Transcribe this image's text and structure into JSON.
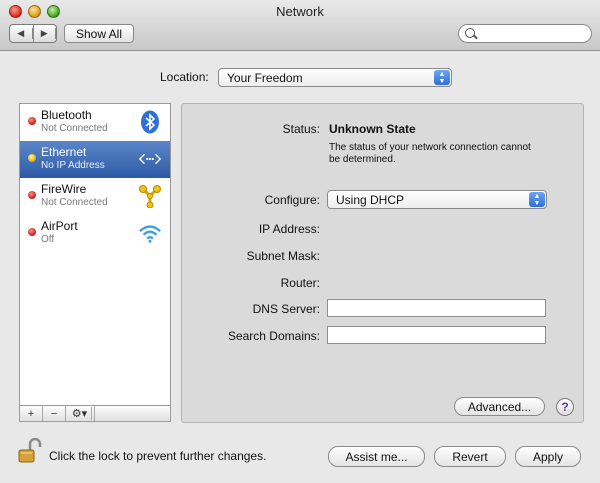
{
  "window": {
    "title": "Network"
  },
  "toolbar": {
    "show_all": "Show All",
    "search_value": ""
  },
  "location": {
    "label": "Location:",
    "value": "Your Freedom"
  },
  "services": [
    {
      "name": "Bluetooth",
      "status": "Not Connected",
      "dot": "red",
      "icon": "bluetooth-icon"
    },
    {
      "name": "Ethernet",
      "status": "No IP Address",
      "dot": "yellow",
      "icon": "ethernet-icon",
      "selected": true
    },
    {
      "name": "FireWire",
      "status": "Not Connected",
      "dot": "red",
      "icon": "firewire-icon"
    },
    {
      "name": "AirPort",
      "status": "Off",
      "dot": "red",
      "icon": "airport-icon"
    }
  ],
  "list_buttons": {
    "add": "+",
    "remove": "−",
    "gear": "⚙▾"
  },
  "detail": {
    "status_label": "Status:",
    "status_value": "Unknown State",
    "status_description": "The status of your network connection cannot be determined.",
    "configure_label": "Configure:",
    "configure_value": "Using DHCP",
    "ip_label": "IP Address:",
    "subnet_label": "Subnet Mask:",
    "router_label": "Router:",
    "dns_label": "DNS Server:",
    "dns_value": "",
    "search_domains_label": "Search Domains:",
    "search_domains_value": "",
    "advanced": "Advanced...",
    "help": "?"
  },
  "footer": {
    "lock_text": "Click the lock to prevent further changes.",
    "assist": "Assist me...",
    "revert": "Revert",
    "apply": "Apply"
  },
  "colors": {
    "selection": "#3d68b4",
    "accent": "#2d6fdb"
  }
}
